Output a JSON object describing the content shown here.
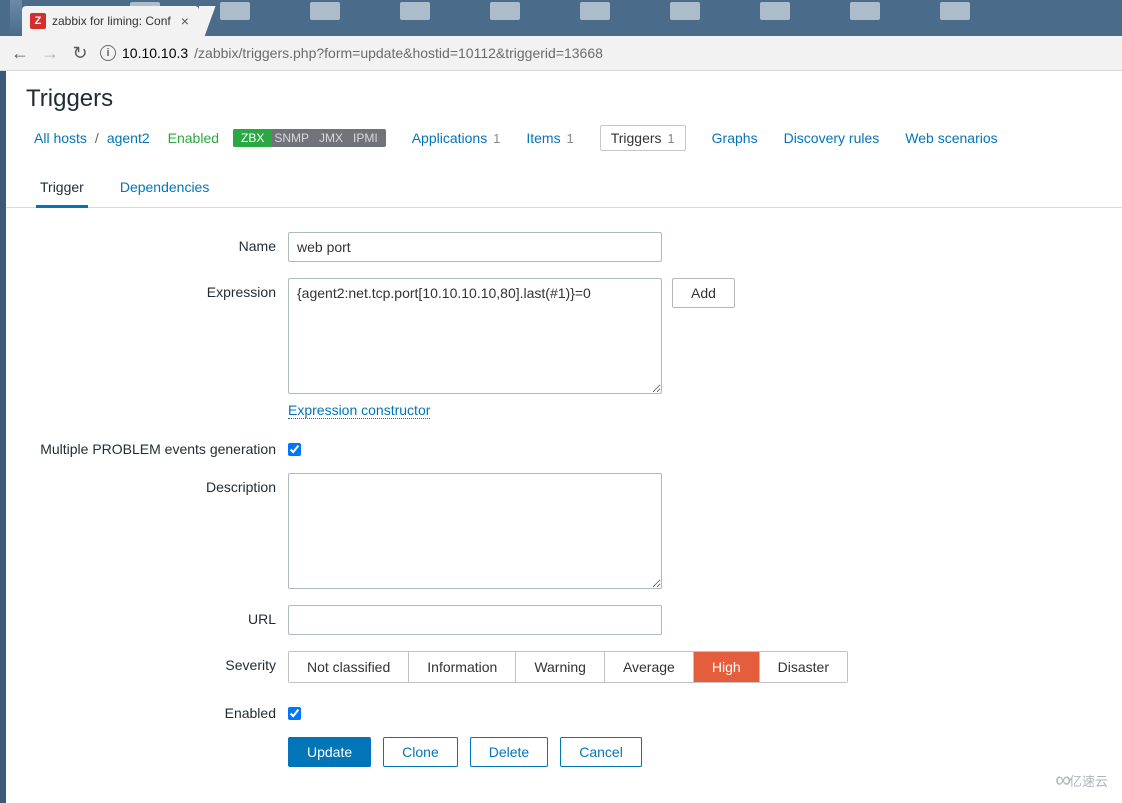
{
  "browser": {
    "tab_title": "zabbix for liming: Conf",
    "url_host": "10.10.10.3",
    "url_path": "/zabbix/triggers.php?form=update&hostid=10112&triggerid=13668"
  },
  "page": {
    "title": "Triggers"
  },
  "hostbar": {
    "all_hosts": "All hosts",
    "host": "agent2",
    "enabled": "Enabled",
    "proto": {
      "zbx": "ZBX",
      "snmp": "SNMP",
      "jmx": "JMX",
      "ipmi": "IPMI"
    },
    "links": {
      "applications": "Applications",
      "applications_n": "1",
      "items": "Items",
      "items_n": "1",
      "triggers": "Triggers",
      "triggers_n": "1",
      "graphs": "Graphs",
      "discovery": "Discovery rules",
      "web": "Web scenarios"
    }
  },
  "subtabs": {
    "trigger": "Trigger",
    "dependencies": "Dependencies"
  },
  "form": {
    "name_label": "Name",
    "name_value": "web port",
    "expression_label": "Expression",
    "expression_value": "{agent2:net.tcp.port[10.10.10.10,80].last(#1)}=0",
    "add_btn": "Add",
    "expr_constructor": "Expression constructor",
    "multi_problem_label": "Multiple PROBLEM events generation",
    "description_label": "Description",
    "url_label": "URL",
    "severity_label": "Severity",
    "severity": {
      "not_classified": "Not classified",
      "information": "Information",
      "warning": "Warning",
      "average": "Average",
      "high": "High",
      "disaster": "Disaster"
    },
    "enabled_label": "Enabled",
    "buttons": {
      "update": "Update",
      "clone": "Clone",
      "delete": "Delete",
      "cancel": "Cancel"
    }
  },
  "watermark": "亿速云"
}
